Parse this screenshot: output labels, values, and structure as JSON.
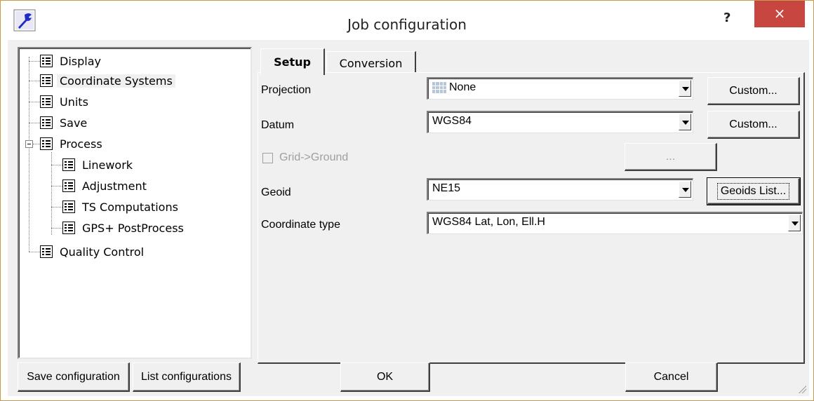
{
  "window": {
    "title": "Job configuration",
    "help_label": "?",
    "close_label": "×"
  },
  "tree": {
    "items": [
      {
        "label": "Display"
      },
      {
        "label": "Coordinate Systems"
      },
      {
        "label": "Units"
      },
      {
        "label": "Save"
      },
      {
        "label": "Process"
      },
      {
        "label": "Linework"
      },
      {
        "label": "Adjustment"
      },
      {
        "label": "TS Computations"
      },
      {
        "label": "GPS+ PostProcess"
      },
      {
        "label": "Quality Control"
      }
    ]
  },
  "tabs": [
    {
      "label": "Setup"
    },
    {
      "label": "Conversion"
    }
  ],
  "setup": {
    "projection_label": "Projection",
    "projection_value": "None",
    "projection_custom": "Custom...",
    "datum_label": "Datum",
    "datum_value": "WGS84",
    "datum_custom": "Custom...",
    "grid_ground_label": "Grid->Ground",
    "grid_ground_button": "...",
    "geoid_label": "Geoid",
    "geoid_value": "NE15",
    "geoids_list_button": "Geoids List...",
    "coordinate_type_label": "Coordinate type",
    "coordinate_type_value": "WGS84 Lat, Lon, Ell.H"
  },
  "footer": {
    "save_configuration": "Save configuration",
    "list_configurations": "List configurations",
    "ok": "OK",
    "cancel": "Cancel"
  }
}
